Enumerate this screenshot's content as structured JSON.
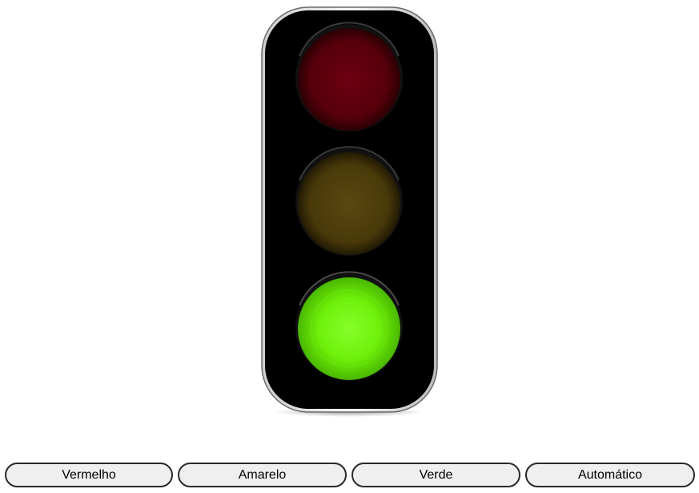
{
  "traffic_light": {
    "lamps": [
      {
        "name": "red",
        "state": "off",
        "color": "#5a0008"
      },
      {
        "name": "yellow",
        "state": "off",
        "color": "#4a3a08"
      },
      {
        "name": "green",
        "state": "on",
        "color": "#6ef00a"
      }
    ],
    "housing_color": "#000000"
  },
  "controls": {
    "red_label": "Vermelho",
    "yellow_label": "Amarelo",
    "green_label": "Verde",
    "auto_label": "Automático"
  }
}
